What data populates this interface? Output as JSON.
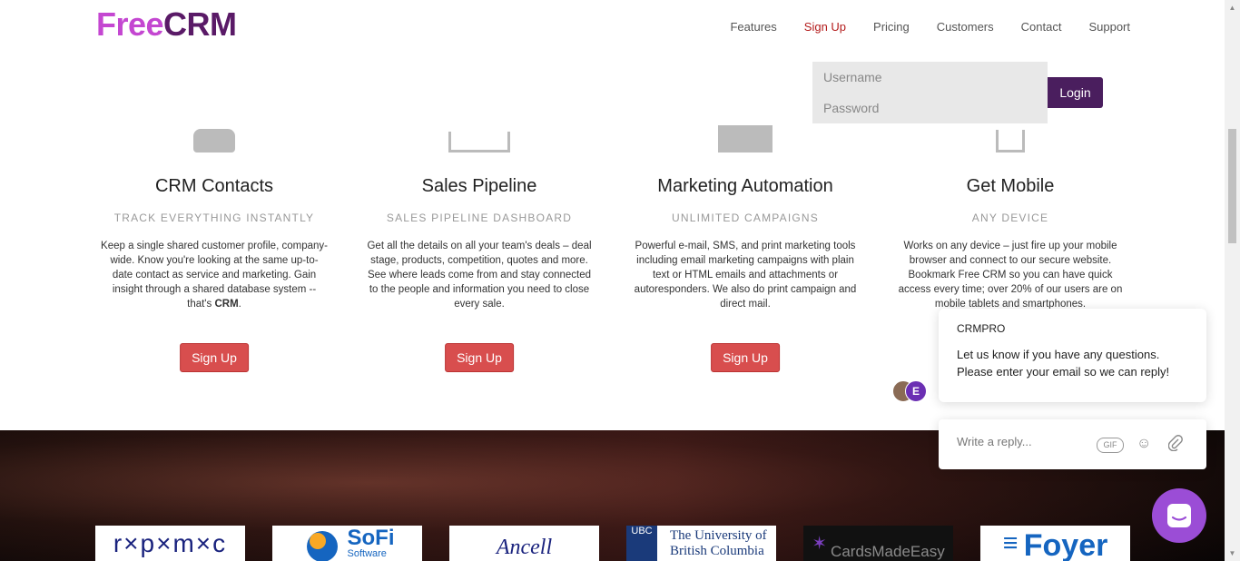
{
  "header": {
    "logo_free": "Free",
    "logo_crm": "CRM",
    "nav": [
      "Features",
      "Sign Up",
      "Pricing",
      "Customers",
      "Contact",
      "Support"
    ],
    "nav_active": "Sign Up"
  },
  "login": {
    "username_placeholder": "Username",
    "password_placeholder": "Password",
    "button": "Login"
  },
  "features": [
    {
      "title": "CRM Contacts",
      "subtitle": "TRACK EVERYTHING INSTANTLY",
      "desc_pre": "Keep a single shared customer profile, company-wide. Know you're looking at the same up-to-date contact as service and marketing. Gain insight through a shared database system -- that's ",
      "desc_bold": "CRM",
      "desc_post": ".",
      "button": "Sign Up"
    },
    {
      "title": "Sales Pipeline",
      "subtitle": "SALES PIPELINE DASHBOARD",
      "desc_pre": "Get all the details on all your team's deals – deal stage, products, competition, quotes and more. See where leads come from and stay connected to the people and information you need to close every sale.",
      "button": "Sign Up"
    },
    {
      "title": "Marketing Automation",
      "subtitle": "UNLIMITED CAMPAIGNS",
      "desc_pre": "Powerful e-mail, SMS, and print marketing tools including email marketing campaigns with plain text or HTML emails and attachments or autoresponders. We also do print campaign and direct mail.",
      "button": "Sign Up"
    },
    {
      "title": "Get Mobile",
      "subtitle": "ANY DEVICE",
      "desc_pre": "Works on any device – just fire up your mobile browser and connect to our secure website. Bookmark Free CRM so you can have quick access every time; over 20% of our users are on mobile tablets and smartphones."
    }
  ],
  "customer_logos": [
    "r×p×m×c",
    "SoFi",
    "Software",
    "Ancell",
    "UBC",
    "The University of",
    "British Columbia",
    "CardsMadeEasy",
    "Foyer"
  ],
  "chat": {
    "from": "CRMPRO",
    "message": "Let us know if you have any questions. Please enter your email so we can reply!",
    "avatar_letter": "E",
    "reply_placeholder": "Write a reply...",
    "gif_label": "GIF"
  }
}
